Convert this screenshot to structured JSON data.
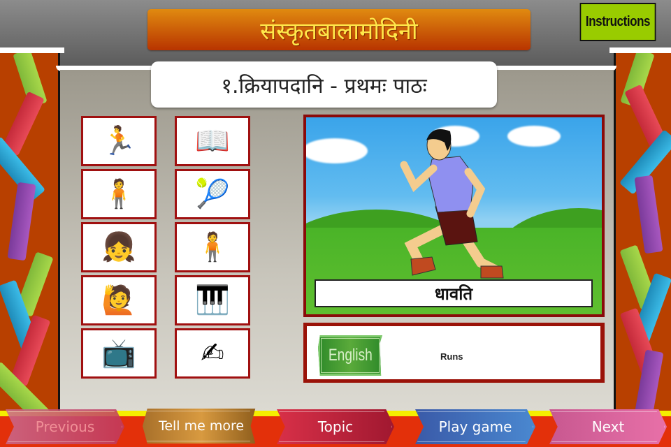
{
  "app": {
    "title": "संस्कृतबालामोदिनी",
    "instructions_label": "Instructions"
  },
  "lesson": {
    "heading": "१.क्रियापदानि - प्रथमः पाठः"
  },
  "thumbnails": [
    {
      "icon": "running-boy-icon",
      "glyph": "🏃"
    },
    {
      "icon": "reading-boy-icon",
      "glyph": "📖"
    },
    {
      "icon": "fat-man-icon",
      "glyph": "🧍"
    },
    {
      "icon": "tennis-player-icon",
      "glyph": "🎾"
    },
    {
      "icon": "sitting-girl-icon",
      "glyph": "👧"
    },
    {
      "icon": "standing-man-icon",
      "glyph": "🧍"
    },
    {
      "icon": "eating-boy-icon",
      "glyph": "🙋"
    },
    {
      "icon": "harmonium-singer-icon",
      "glyph": "🎹"
    },
    {
      "icon": "watching-tv-icon",
      "glyph": "📺"
    },
    {
      "icon": "writing-girl-icon",
      "glyph": "✍"
    }
  ],
  "current_word": {
    "sanskrit": "धावति",
    "english_label": "English",
    "translation": "Runs"
  },
  "nav": {
    "previous": "Previous",
    "tell_me_more": "Tell me more",
    "topic": "Topic",
    "play_game": "Play game",
    "next": "Next"
  },
  "colors": {
    "title_bg": "#c85a08",
    "title_text": "#ffe84a",
    "instructions_bg": "#99cc00",
    "frame_red": "#9a1208",
    "side_panel": "#b84000",
    "bottom_bar": "#e3300a"
  }
}
